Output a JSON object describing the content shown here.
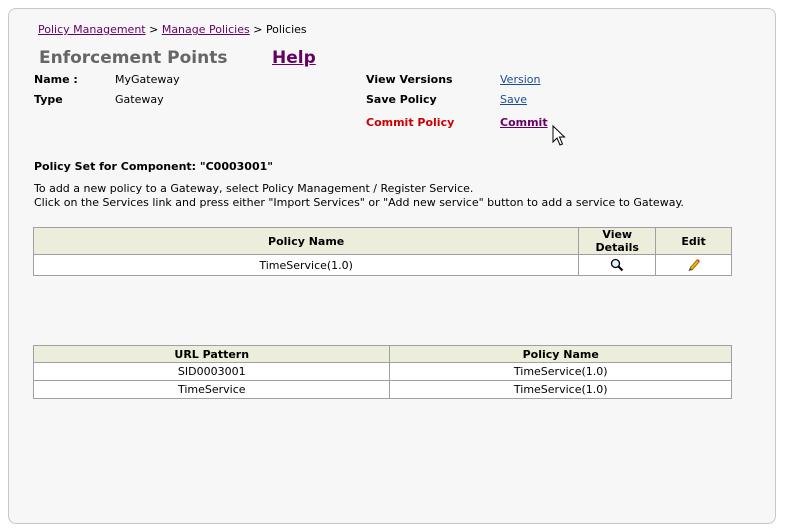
{
  "breadcrumb": {
    "items": [
      "Policy Management",
      "Manage Policies"
    ],
    "separator": ">",
    "current": "Policies"
  },
  "header": {
    "title": "Enforcement Points",
    "help_label": "Help"
  },
  "details": {
    "name_label": "Name :",
    "name_value": "MyGateway",
    "type_label": "Type",
    "type_value": "Gateway"
  },
  "actions": {
    "view_versions_label": "View Versions",
    "version_link": "Version",
    "save_policy_label": "Save Policy",
    "save_link": "Save",
    "commit_policy_label": "Commit Policy",
    "commit_link": "Commit"
  },
  "policy_set": {
    "title": "Policy Set for Component: \"C0003001\"",
    "instructions": [
      "To add a new policy to a Gateway, select Policy Management / Register Service.",
      "Click on the Services link and press either \"Import Services\" or \"Add new service\" button to add a service to Gateway."
    ]
  },
  "policy_table": {
    "headers": [
      "Policy Name",
      "View Details",
      "Edit"
    ],
    "rows": [
      {
        "policy_name": "TimeService(1.0)",
        "view_icon": "magnifier-icon",
        "edit_icon": "pencil-icon"
      }
    ]
  },
  "url_table": {
    "headers": [
      "URL Pattern",
      "Policy Name"
    ],
    "rows": [
      {
        "url_pattern": "SID0003001",
        "policy_name": "TimeService(1.0)"
      },
      {
        "url_pattern": "TimeService",
        "policy_name": "TimeService(1.0)"
      }
    ]
  },
  "colors": {
    "panel_bg": "#f7f7f7",
    "header_bg": "#ededdb",
    "link_purple": "#660066",
    "link_blue": "#1a4d99",
    "commit_red": "#cc0000",
    "title_gray": "#666666"
  }
}
